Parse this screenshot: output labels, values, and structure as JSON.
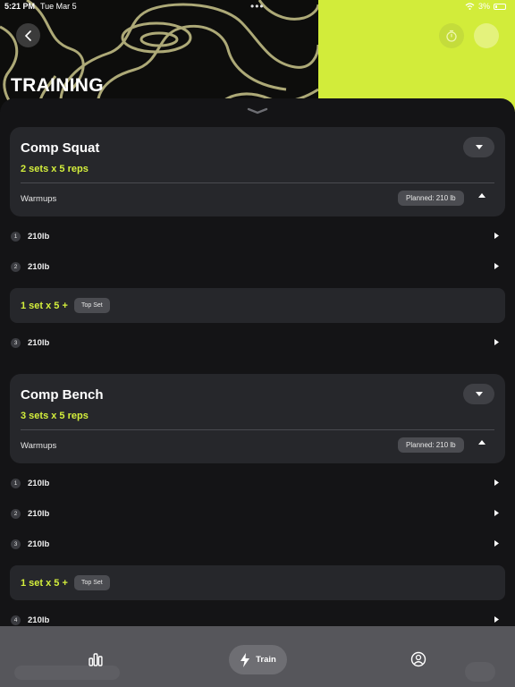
{
  "status_bar": {
    "time": "5:21 PM",
    "date": "Tue Mar 5",
    "battery": "3%"
  },
  "header": {
    "title": "TRAINING"
  },
  "colors": {
    "accent": "#d4ef3c",
    "background": "#141416",
    "card": "#26272b"
  },
  "exercises": [
    {
      "name": "Comp Squat",
      "scheme": "2 sets x 5 reps",
      "warmups_label": "Warmups",
      "planned_badge": "Planned: 210 lb",
      "warmup_sets": [
        {
          "num": "1",
          "weight": "210lb"
        },
        {
          "num": "2",
          "weight": "210lb"
        }
      ],
      "top_set": {
        "label": "1 set x 5 +",
        "badge": "Top Set"
      },
      "work_sets": [
        {
          "num": "3",
          "weight": "210lb"
        }
      ]
    },
    {
      "name": "Comp Bench",
      "scheme": "3 sets x 5 reps",
      "warmups_label": "Warmups",
      "planned_badge": "Planned: 210 lb",
      "warmup_sets": [
        {
          "num": "1",
          "weight": "210lb"
        },
        {
          "num": "2",
          "weight": "210lb"
        },
        {
          "num": "3",
          "weight": "210lb"
        }
      ],
      "top_set": {
        "label": "1 set x 5 +",
        "badge": "Top Set"
      },
      "work_sets": [
        {
          "num": "4",
          "weight": "210lb"
        }
      ]
    }
  ],
  "tabbar": {
    "stats_icon": "bar-chart-icon",
    "train_label": "Train",
    "train_icon": "lightning-icon",
    "profile_icon": "user-circle-icon"
  }
}
